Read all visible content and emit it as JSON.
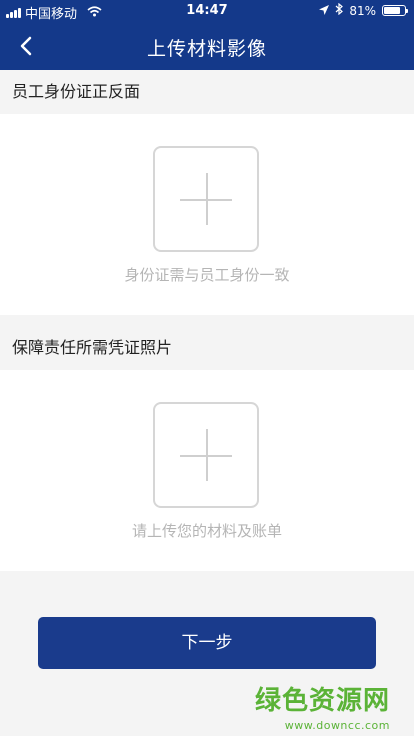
{
  "status_bar": {
    "carrier": "中国移动",
    "time": "14:47",
    "battery_percent": "81%",
    "battery_level": 0.81
  },
  "nav": {
    "title": "上传材料影像"
  },
  "sections": [
    {
      "title": "员工身份证正反面",
      "hint": "身份证需与员工身份一致"
    },
    {
      "title": "保障责任所需凭证照片",
      "hint": "请上传您的材料及账单"
    }
  ],
  "next_button": {
    "label": "下一步"
  },
  "watermark": {
    "title": "绿色资源网",
    "url": "www.downcc.com"
  },
  "colors": {
    "primary": "#14398a",
    "button": "#1a3b8c",
    "watermark": "#5bb337"
  }
}
